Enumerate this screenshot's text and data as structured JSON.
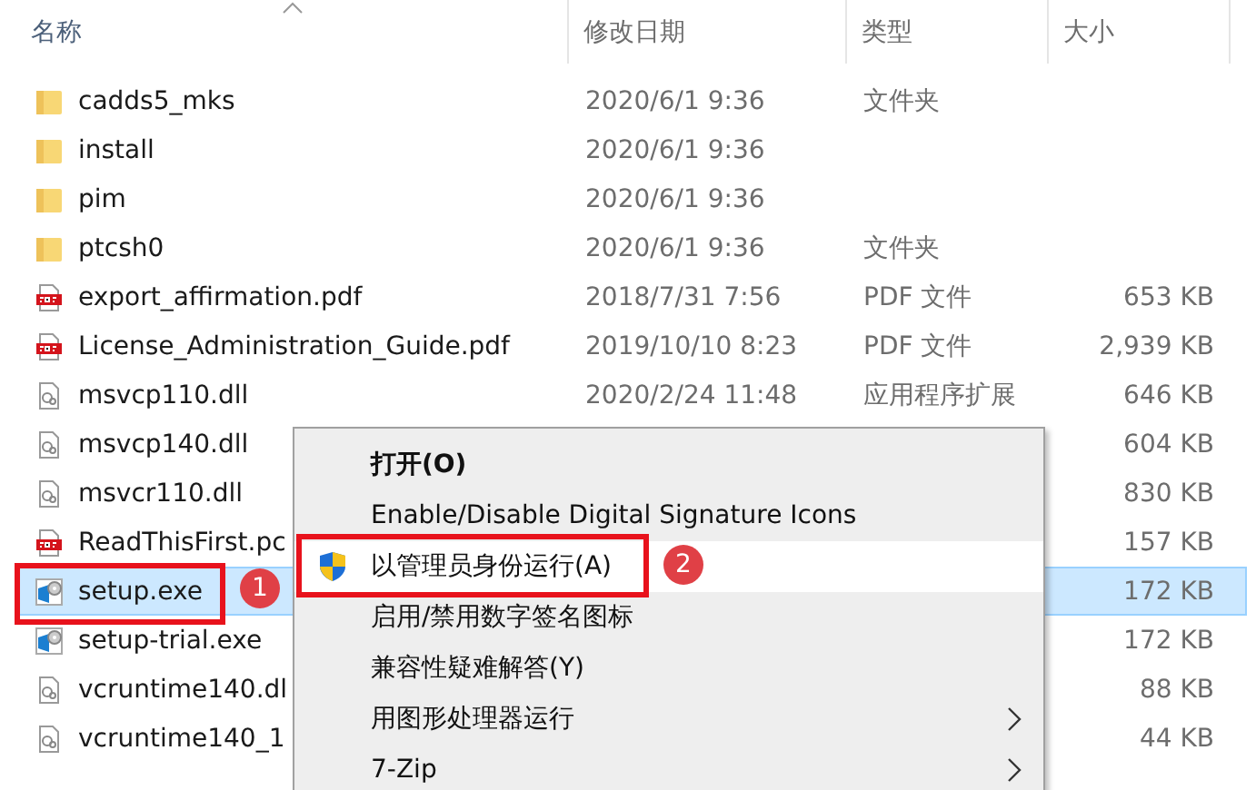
{
  "columns": [
    {
      "label": "名称",
      "sorted": true
    },
    {
      "label": "修改日期",
      "sorted": false
    },
    {
      "label": "类型",
      "sorted": false
    },
    {
      "label": "大小",
      "sorted": false
    }
  ],
  "files": [
    {
      "kind": "folder",
      "name": "cadds5_mks",
      "date": "2020/6/1 9:36",
      "type": "文件夹",
      "selected": false
    },
    {
      "kind": "folder",
      "name": "install",
      "date": "2020/6/1 9:36",
      "selected": false
    },
    {
      "kind": "folder",
      "name": "pim",
      "date": "2020/6/1 9:36",
      "selected": false
    },
    {
      "kind": "folder",
      "name": "ptcsh0",
      "date": "2020/6/1 9:36",
      "type": "文件夹",
      "selected": false
    },
    {
      "kind": "pdf",
      "name": "export_affirmation.pdf",
      "date": "2018/7/31 7:56",
      "type": "PDF 文件",
      "size": "653 KB",
      "selected": false
    },
    {
      "kind": "pdf",
      "name": "License_Administration_Guide.pdf",
      "date": "2019/10/10 8:23",
      "type": "PDF 文件",
      "size": "2,939 KB",
      "selected": false
    },
    {
      "kind": "dll",
      "name": "msvcp110.dll",
      "date": "2020/2/24 11:48",
      "type": "应用程序扩展",
      "size": "646 KB",
      "selected": false
    },
    {
      "kind": "dll",
      "name": "msvcp140.dll",
      "size": "604 KB",
      "selected": false
    },
    {
      "kind": "dll",
      "name": "msvcr110.dll",
      "size": "830 KB",
      "selected": false
    },
    {
      "kind": "pdf",
      "name": "ReadThisFirst.pc",
      "size": "157 KB",
      "selected": false
    },
    {
      "kind": "exe",
      "name": "setup.exe",
      "size": "172 KB",
      "selected": true
    },
    {
      "kind": "exe",
      "name": "setup-trial.exe",
      "size": "172 KB",
      "selected": false
    },
    {
      "kind": "dll",
      "name": "vcruntime140.dl",
      "size": "88 KB",
      "selected": false
    },
    {
      "kind": "dll",
      "name": "vcruntime140_1",
      "size": "44 KB",
      "selected": false
    }
  ],
  "context_menu": [
    {
      "label": "打开(O)",
      "bold": true,
      "selected": false
    },
    {
      "label": "Enable/Disable Digital Signature Icons",
      "selected": false
    },
    {
      "label": "以管理员身份运行(A)",
      "shield": true,
      "selected": true
    },
    {
      "label": "启用/禁用数字签名图标",
      "selected": false
    },
    {
      "label": "兼容性疑难解答(Y)",
      "selected": false
    },
    {
      "label": "用图形处理器运行",
      "submenu": true,
      "selected": false
    },
    {
      "label": "7-Zip",
      "submenu": true,
      "selected": false
    }
  ],
  "annotations": [
    {
      "number": "1"
    },
    {
      "number": "2"
    }
  ]
}
